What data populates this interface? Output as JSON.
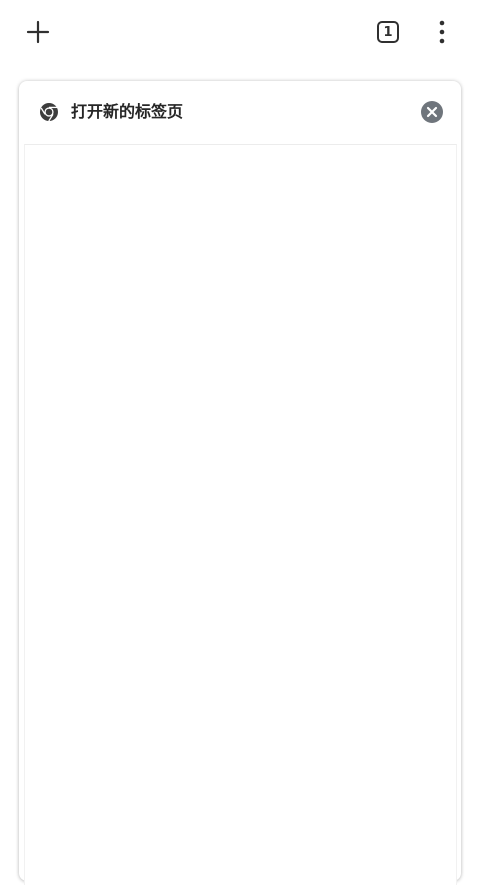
{
  "toolbar": {
    "new_tab_icon": "plus-icon",
    "tab_count": "1",
    "menu_icon": "more-vert-icon"
  },
  "tab": {
    "title": "打开新的标签页",
    "favicon": "chrome-icon",
    "close_icon": "close-circle-icon"
  },
  "colors": {
    "icon": "#303030",
    "close_bg": "#6f757c",
    "title": "#262626"
  }
}
